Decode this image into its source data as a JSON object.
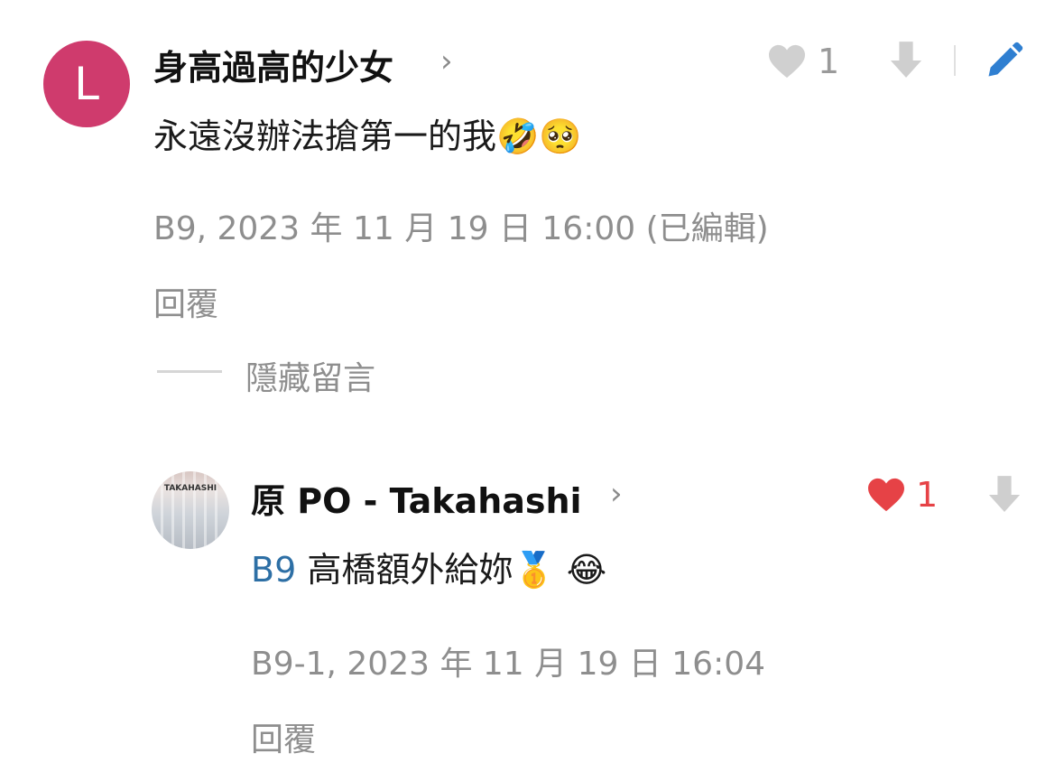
{
  "comment": {
    "avatar_letter": "L",
    "avatar_color": "#cf3b6d",
    "author": "身高過高的少女",
    "content": "永遠沒辦法搶第一的我",
    "emojis": [
      "🤣",
      "🥺"
    ],
    "likes": "1",
    "meta": "B9, 2023 年 11 月 19 日 16:00 (已編輯)",
    "reply_label": "回覆",
    "hide_label": "隱藏留言"
  },
  "reply": {
    "avatar_text": "TAKAHASHI",
    "author": "原 PO - Takahashi",
    "floor_ref": "B9",
    "content": "高橋額外給妳",
    "emojis": [
      "🥇",
      "😂"
    ],
    "likes": "1",
    "meta": "B9-1, 2023 年 11 月 19 日 16:04",
    "reply_label": "回覆"
  },
  "colors": {
    "liked_heart": "#e64246",
    "link_blue": "#2d6fa5",
    "edit_blue": "#2f7fd1",
    "muted": "#8e8e8e"
  }
}
